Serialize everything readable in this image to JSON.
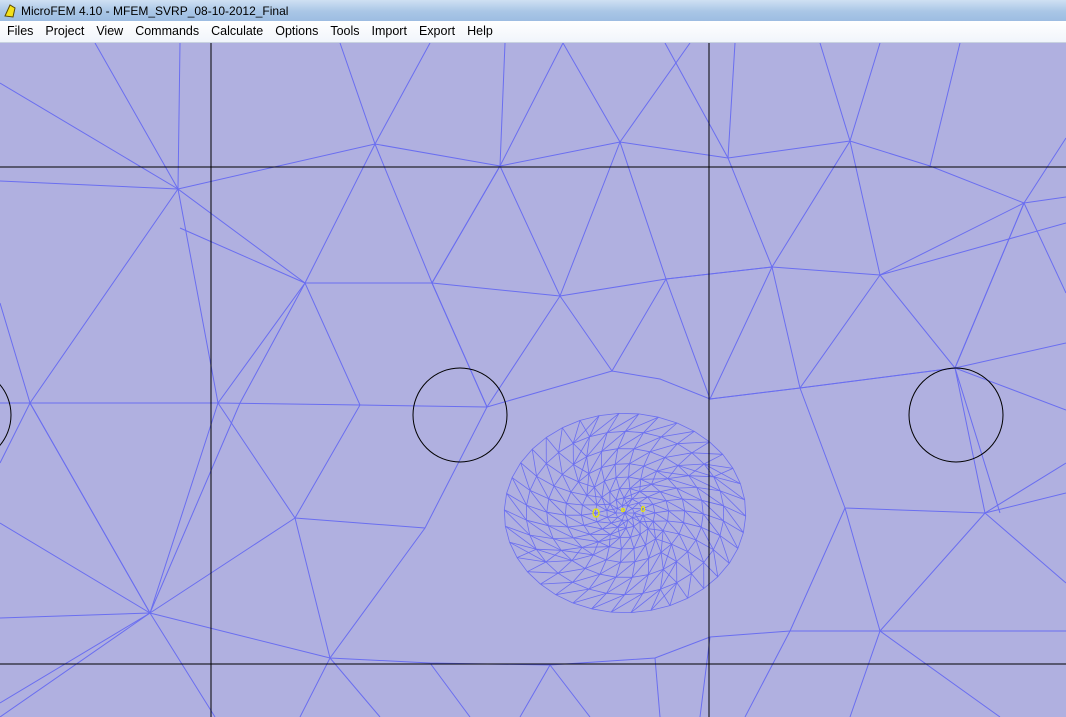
{
  "window": {
    "title": "MicroFEM 4.10 - MFEM_SVRP_08-10-2012_Final"
  },
  "menu": [
    {
      "label": "Files"
    },
    {
      "label": "Project"
    },
    {
      "label": "View"
    },
    {
      "label": "Commands"
    },
    {
      "label": "Calculate"
    },
    {
      "label": "Options"
    },
    {
      "label": "Tools"
    },
    {
      "label": "Import"
    },
    {
      "label": "Export"
    },
    {
      "label": "Help"
    }
  ],
  "colors": {
    "background": "#b0b0e0",
    "mesh": "#6a6ef0",
    "grid": "#000000",
    "circle": "#000000",
    "marker": "#e6e600"
  }
}
